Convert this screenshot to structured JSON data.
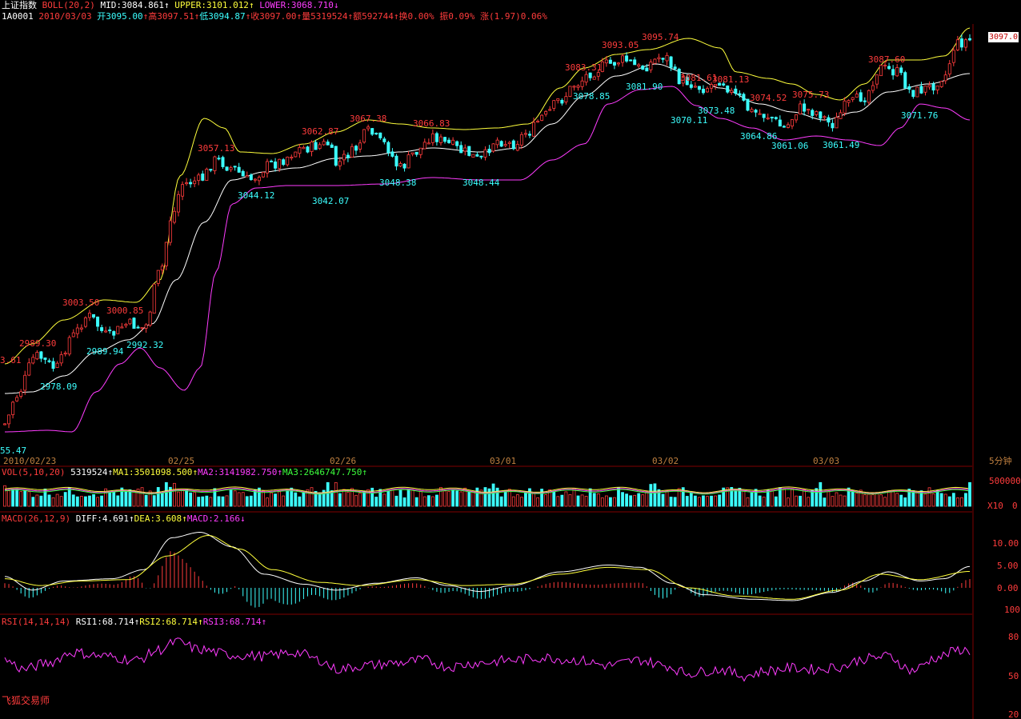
{
  "header": {
    "title": "上证指数",
    "indicator": "BOLL(20,2)",
    "mid": "MID:3084.861",
    "upper": "UPPER:3101.012",
    "lower": "LOWER:3068.710",
    "up_arrow": "↑",
    "down_arrow": "↓",
    "code": "1A0001",
    "date": "2010/03/03",
    "open": "开3095.00",
    "high": "高3097.51",
    "low": "低3094.87",
    "close": "收3097.00",
    "volume": "量5319524",
    "amount": "额592744",
    "turnover": "换0.00%",
    "amplitude": "振0.09%",
    "change": "涨(1.97)0.06%"
  },
  "current_price_label": "3097.0",
  "period_label": "5分钟",
  "vol_header": {
    "name": "VOL(5,10,20)",
    "value": "5319524",
    "ma1": "MA1:3501098.500",
    "ma2": "MA2:3141982.750",
    "ma3": "MA3:2646747.750"
  },
  "macd_header": {
    "name": "MACD(26,12,9)",
    "diff": "DIFF:4.691",
    "dea": "DEA:3.608",
    "macd": "MACD:2.166"
  },
  "rsi_header": {
    "name": "RSI(14,14,14)",
    "rsi1": "RSI1:68.714",
    "rsi2": "RSI2:68.714",
    "rsi3": "RSI3:68.714"
  },
  "brand": "飞狐交易师",
  "colors": {
    "up": "#ff3c3c",
    "down": "#3cffff",
    "upper_band": "#ffff3c",
    "mid_band": "#ffffff",
    "lower_band": "#ff3cff",
    "axis_text": "#ff3c3c",
    "date_text": "#c08040"
  },
  "chart_data": [
    {
      "type": "candlestick",
      "title": "上证指数 BOLL(20,2)",
      "x_ticks": [
        "2010/02/23",
        "02/25",
        "02/26",
        "03/01",
        "03/02",
        "03/03"
      ],
      "ylim": [
        2955,
        3101
      ],
      "price_labels_high": [
        {
          "value": "3003.50"
        },
        {
          "value": "3000.85"
        },
        {
          "value": "2989.30"
        },
        {
          "value": "3057.13"
        },
        {
          "value": "3062.87"
        },
        {
          "value": "3067.38"
        },
        {
          "value": "3066.83"
        },
        {
          "value": "3093.05"
        },
        {
          "value": "3095.74"
        },
        {
          "value": "3083.31"
        },
        {
          "value": "3081.61"
        },
        {
          "value": "3081.13"
        },
        {
          "value": "3074.52"
        },
        {
          "value": "3075.73"
        },
        {
          "value": "3087.60"
        },
        {
          "value": "3.61"
        }
      ],
      "price_labels_low": [
        {
          "value": "2978.09"
        },
        {
          "value": "2989.94"
        },
        {
          "value": "2992.32"
        },
        {
          "value": "3044.12"
        },
        {
          "value": "3042.07"
        },
        {
          "value": "3048.38"
        },
        {
          "value": "3048.44"
        },
        {
          "value": "3078.85"
        },
        {
          "value": "3081.90"
        },
        {
          "value": "3070.11"
        },
        {
          "value": "3073.48"
        },
        {
          "value": "3064.86"
        },
        {
          "value": "3061.06"
        },
        {
          "value": "3061.49"
        },
        {
          "value": "3071.76"
        },
        {
          "value": "55.47"
        }
      ],
      "bands": [
        "UPPER",
        "MID",
        "LOWER"
      ]
    },
    {
      "type": "bar",
      "title": "VOL(5,10,20)",
      "y_ticks": [
        "500000",
        "0"
      ],
      "unit_label": "X10"
    },
    {
      "type": "bar",
      "title": "MACD(26,12,9)",
      "y_ticks": [
        "10.00",
        "5.00",
        "0.00"
      ],
      "series": [
        {
          "name": "DIFF"
        },
        {
          "name": "DEA"
        },
        {
          "name": "MACD"
        }
      ]
    },
    {
      "type": "line",
      "title": "RSI(14,14,14)",
      "y_ticks": [
        "100",
        "80",
        "50",
        "20"
      ],
      "series": [
        {
          "name": "RSI1"
        },
        {
          "name": "RSI2"
        },
        {
          "name": "RSI3"
        }
      ]
    }
  ]
}
